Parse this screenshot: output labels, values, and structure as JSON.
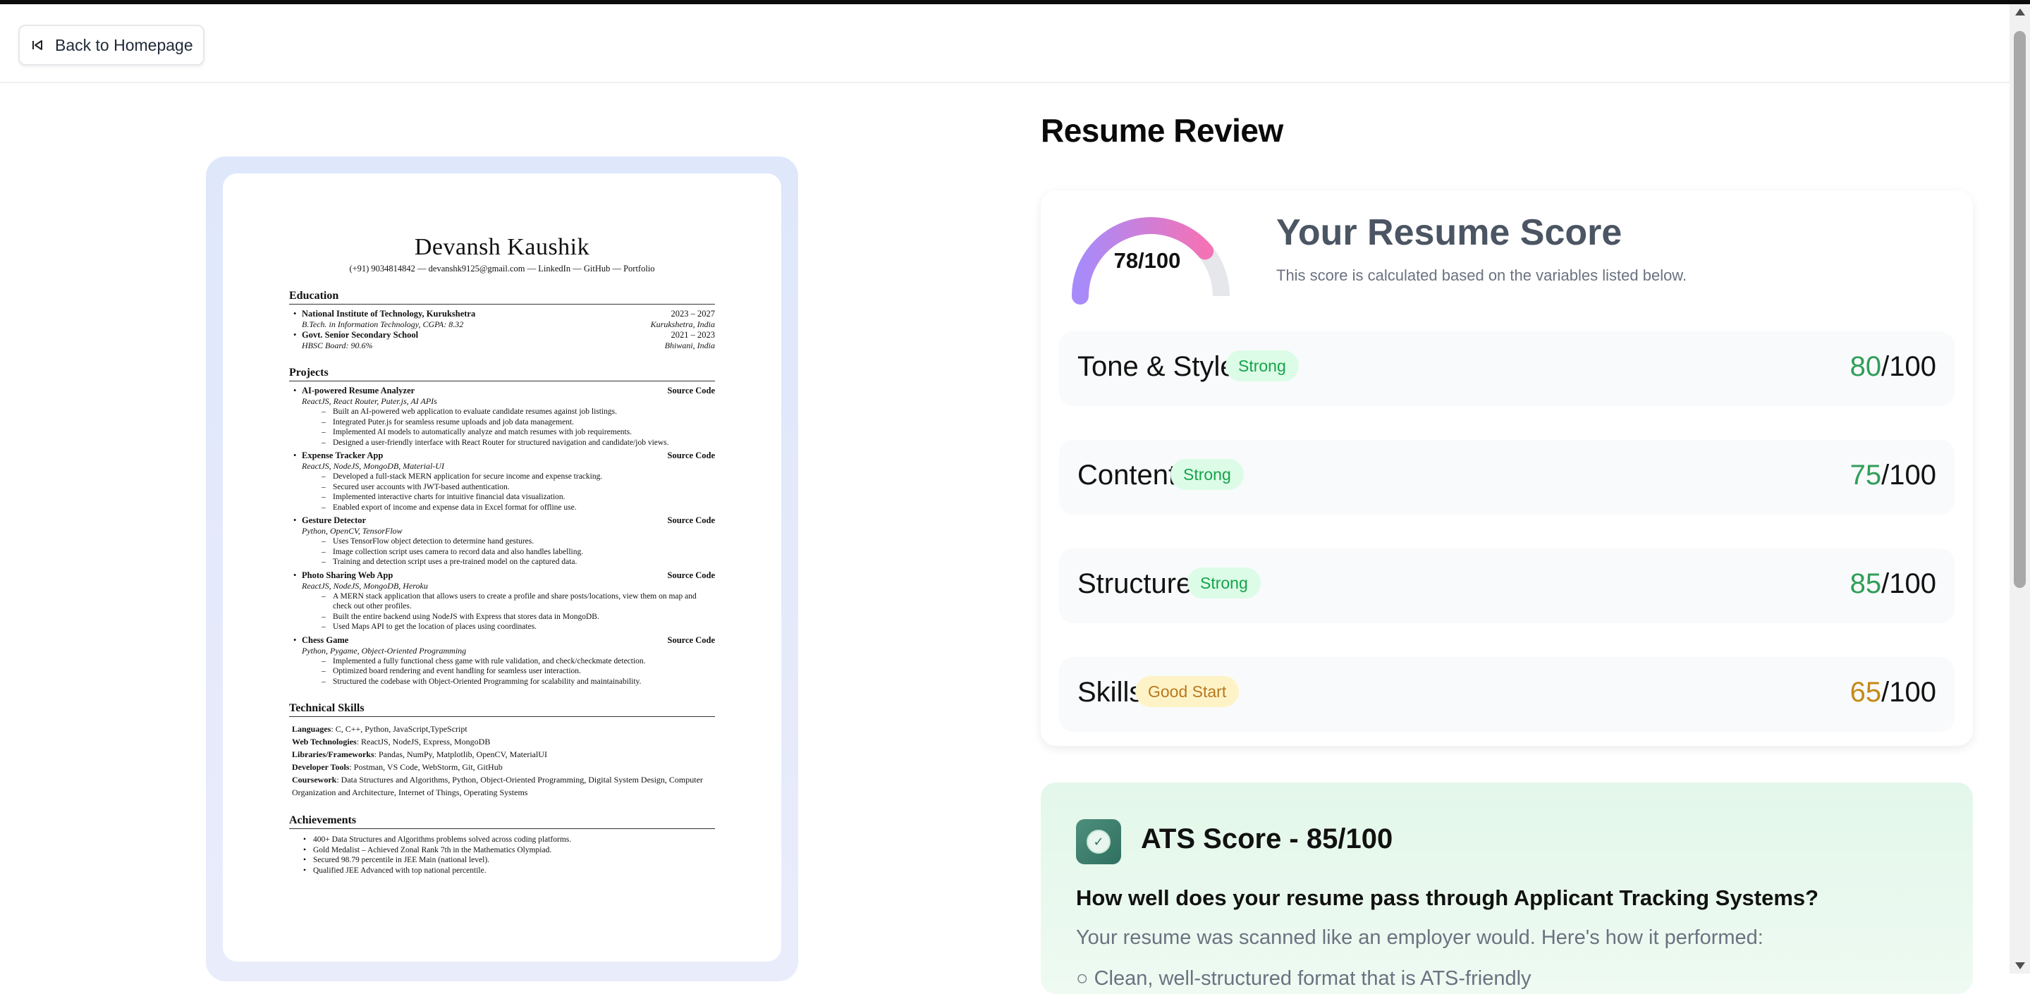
{
  "header": {
    "back_label": "Back to Homepage"
  },
  "page": {
    "title": "Resume Review"
  },
  "resume": {
    "name": "Devansh Kaushik",
    "contact": "(+91) 9034814842 — devanshk9125@gmail.com — LinkedIn — GitHub — Portfolio",
    "education_heading": "Education",
    "education": [
      {
        "title": "National Institute of Technology, Kurukshetra",
        "dates": "2023 – 2027",
        "sub": "B.Tech. in Information Technology, CGPA: 8.32",
        "place": "Kurukshetra, India"
      },
      {
        "title": "Govt. Senior Secondary School",
        "dates": "2021 – 2023",
        "sub": "HBSC Board: 90.6%",
        "place": "Bhiwani, India"
      }
    ],
    "projects_heading": "Projects",
    "projects": [
      {
        "title": "AI-powered Resume Analyzer",
        "link": "Source Code",
        "stack": "ReactJS, React Router, Puter.js, AI APIs",
        "bullets": [
          "Built an AI-powered web application to evaluate candidate resumes against job listings.",
          "Integrated Puter.js for seamless resume uploads and job data management.",
          "Implemented AI models to automatically analyze and match resumes with job requirements.",
          "Designed a user-friendly interface with React Router for structured navigation and candidate/job views."
        ]
      },
      {
        "title": "Expense Tracker App",
        "link": "Source Code",
        "stack": "ReactJS, NodeJS, MongoDB, Material-UI",
        "bullets": [
          "Developed a full-stack MERN application for secure income and expense tracking.",
          "Secured user accounts with JWT-based authentication.",
          "Implemented interactive charts for intuitive financial data visualization.",
          "Enabled export of income and expense data in Excel format for offline use."
        ]
      },
      {
        "title": "Gesture Detector",
        "link": "Source Code",
        "stack": "Python, OpenCV, TensorFlow",
        "bullets": [
          "Uses TensorFlow object detection to determine hand gestures.",
          "Image collection script uses camera to record data and also handles labelling.",
          "Training and detection script uses a pre-trained model on the captured data."
        ]
      },
      {
        "title": "Photo Sharing Web App",
        "link": "Source Code",
        "stack": "ReactJS, NodeJS, MongoDB, Heroku",
        "bullets": [
          "A MERN stack application that allows users to create a profile and share posts/locations, view them on map and check out other profiles.",
          "Built the entire backend using NodeJS with Express that stores data in MongoDB.",
          "Used Maps API to get the location of places using coordinates."
        ]
      },
      {
        "title": "Chess Game",
        "link": "Source Code",
        "stack": "Python, Pygame, Object-Oriented Programming",
        "bullets": [
          "Implemented a fully functional chess game with rule validation, and check/checkmate detection.",
          "Optimized board rendering and event handling for seamless user interaction.",
          "Structured the codebase with Object-Oriented Programming for scalability and maintainability."
        ]
      }
    ],
    "skills_heading": "Technical Skills",
    "skills": [
      {
        "label": "Languages",
        "value": ": C, C++, Python, JavaScript,TypeScript"
      },
      {
        "label": "Web Technologies",
        "value": ": ReactJS, NodeJS, Express, MongoDB"
      },
      {
        "label": "Libraries/Frameworks",
        "value": ": Pandas, NumPy, Matplotlib, OpenCV, MaterialUI"
      },
      {
        "label": "Developer Tools",
        "value": ": Postman, VS Code, WebStorm, Git, GitHub"
      },
      {
        "label": "Coursework",
        "value": ": Data Structures and Algorithms, Python, Object-Oriented Programming, Digital System Design, Computer Organization and Architecture, Internet of Things, Operating Systems"
      }
    ],
    "achievements_heading": "Achievements",
    "achievements": [
      "400+ Data Structures and Algorithms problems solved across coding platforms.",
      "Gold Medalist – Achieved Zonal Rank 7th in the Mathematics Olympiad.",
      "Secured 98.79 percentile in JEE Main (national level).",
      "Qualified JEE Advanced with top national percentile."
    ]
  },
  "summary": {
    "gauge_score": 78,
    "gauge_label": "78/100",
    "title": "Your Resume Score",
    "description": "This score is calculated based on the variables listed below.",
    "colors": {
      "gauge_start": "#a78bfa",
      "gauge_end": "#f472b6",
      "gauge_track": "#e5e7eb"
    },
    "categories": [
      {
        "name": "Tone & Style",
        "badge": "Strong",
        "badge_type": "strong",
        "score": "80",
        "of": "/100",
        "score_color": "green"
      },
      {
        "name": "Content",
        "badge": "Strong",
        "badge_type": "strong",
        "score": "75",
        "of": "/100",
        "score_color": "green"
      },
      {
        "name": "Structure",
        "badge": "Strong",
        "badge_type": "strong",
        "score": "85",
        "of": "/100",
        "score_color": "green"
      },
      {
        "name": "Skills",
        "badge": "Good Start",
        "badge_type": "good",
        "score": "65",
        "of": "/100",
        "score_color": "amber"
      }
    ]
  },
  "ats": {
    "title": "ATS Score - 85/100",
    "question": "How well does your resume pass through Applicant Tracking Systems?",
    "description": "Your resume was scanned like an employer would. Here's how it performed:",
    "next_item": "Clean, well-structured format that is ATS-friendly"
  }
}
